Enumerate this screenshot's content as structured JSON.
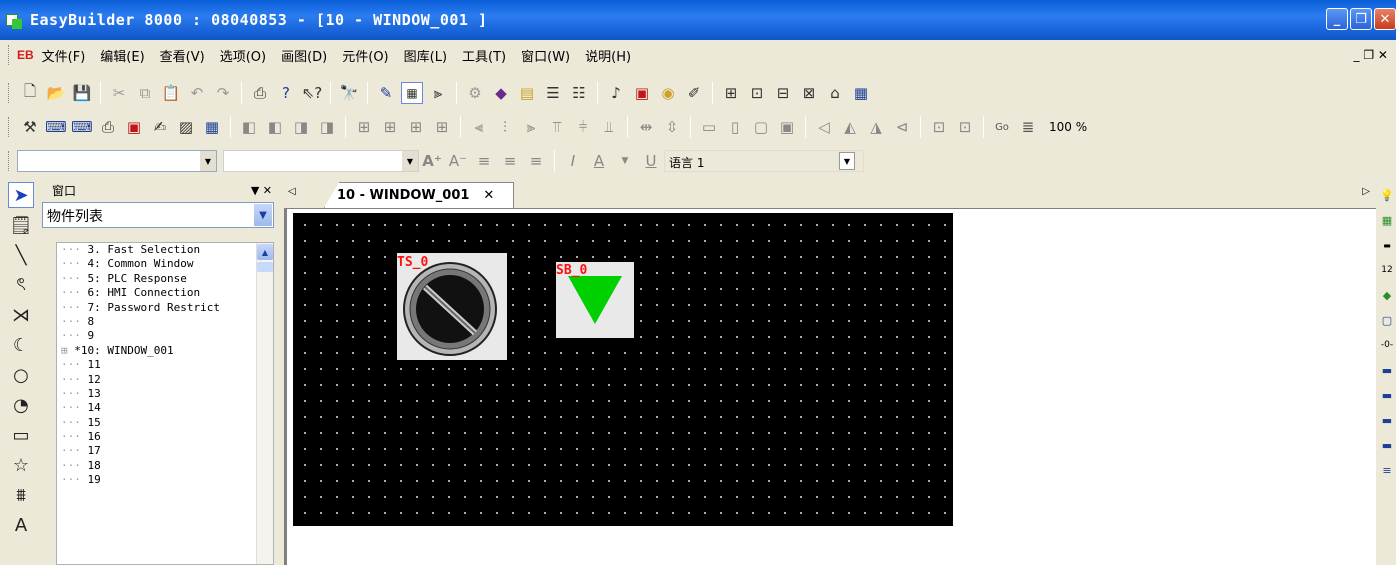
{
  "titlebar": {
    "title": "EasyBuilder 8000 : 08040853 - [10 - WINDOW_001 ]",
    "minimize": "_",
    "restore": "❐",
    "close": "✕"
  },
  "menubar": {
    "logo": "EB",
    "items": [
      "文件(F)",
      "编辑(E)",
      "查看(V)",
      "选项(O)",
      "画图(D)",
      "元件(O)",
      "图库(L)",
      "工具(T)",
      "窗口(W)",
      "说明(H)"
    ],
    "mdi_controls": "_ ❐ ✕"
  },
  "toolbar3": {
    "zoom": "100 %"
  },
  "toolbar4": {
    "language": "语言 1"
  },
  "panel": {
    "title": "窗口",
    "controls": "▼ ✕",
    "dropdown_value": "物件列表",
    "tree": [
      "3. Fast Selection",
      "4: Common Window",
      "5: PLC Response",
      "6: HMI Connection",
      "7: Password Restrict",
      "8",
      "9",
      "*10: WINDOW_001",
      "11",
      "12",
      "13",
      "14",
      "15",
      "16",
      "17",
      "18",
      "19"
    ]
  },
  "tabs": {
    "active_label": "10 - WINDOW_001",
    "close": "✕"
  },
  "canvas": {
    "toggle_switch_label": "TS_0",
    "set_bit_label": "SB_0"
  },
  "colors": {
    "title_bar": "#0a5fd8",
    "canvas_bg": "#000000",
    "label_red": "#ff1010",
    "triangle_green": "#00d000"
  }
}
